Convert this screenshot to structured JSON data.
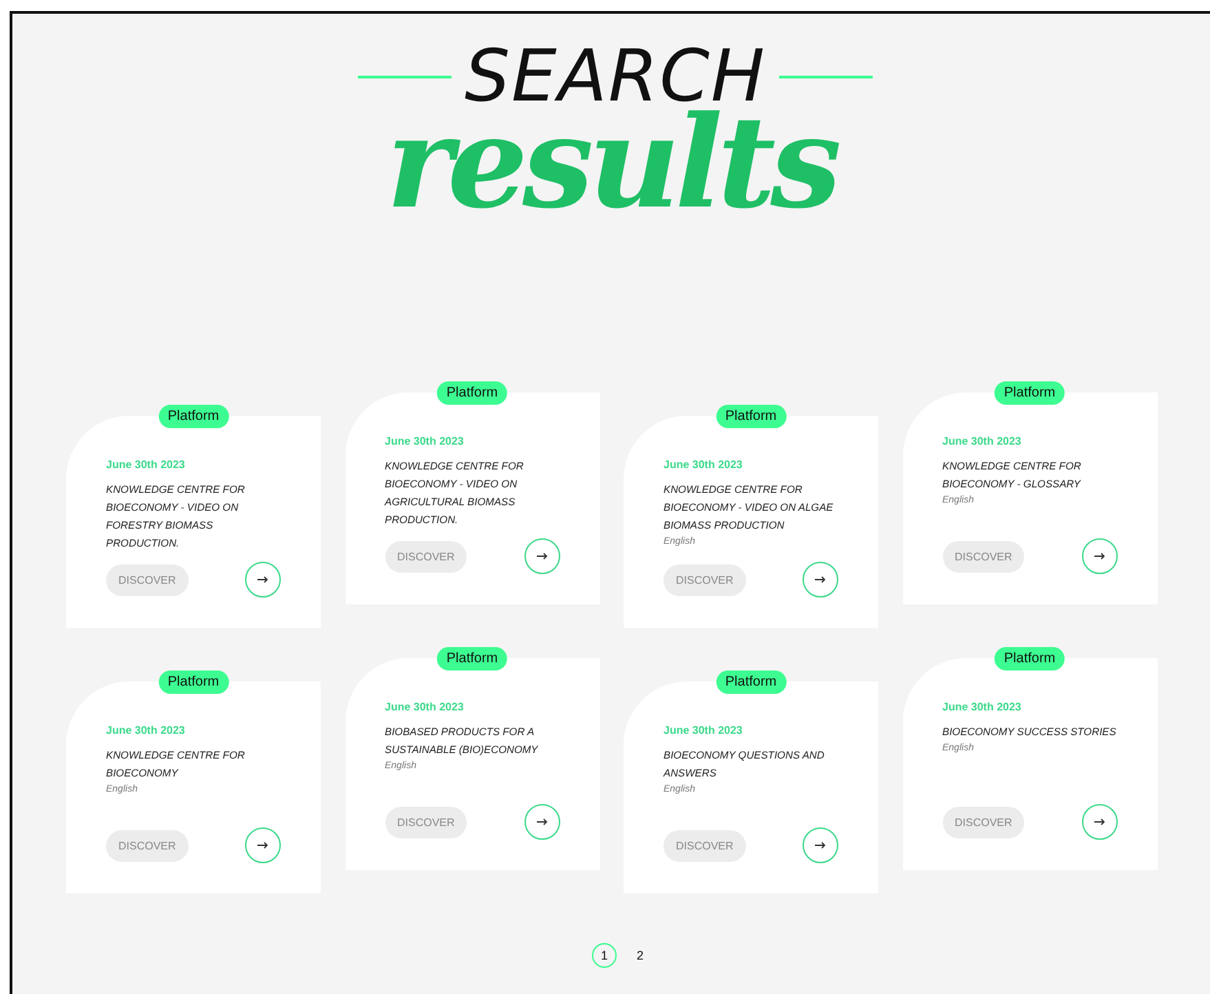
{
  "header": {
    "title_top": "SEARCH",
    "title_script": "results"
  },
  "results": [
    {
      "badge": "Platform",
      "date": "June 30th 2023",
      "title": "KNOWLEDGE CENTRE FOR BIOECONOMY - VIDEO ON FORESTRY BIOMASS PRODUCTION.",
      "button": "DISCOVER"
    },
    {
      "badge": "Platform",
      "date": "June 30th 2023",
      "title": "KNOWLEDGE CENTRE FOR BIOECONOMY - VIDEO ON AGRICULTURAL BIOMASS PRODUCTION.",
      "button": "DISCOVER"
    },
    {
      "badge": "Platform",
      "date": "June 30th 2023",
      "title": "KNOWLEDGE CENTRE FOR BIOECONOMY - VIDEO ON ALGAE BIOMASS PRODUCTION",
      "language": "English",
      "button": "DISCOVER"
    },
    {
      "badge": "Platform",
      "date": "June 30th 2023",
      "title": "KNOWLEDGE CENTRE FOR BIOECONOMY - GLOSSARY",
      "language": "English",
      "button": "DISCOVER"
    },
    {
      "badge": "Platform",
      "date": "June 30th 2023",
      "title": "KNOWLEDGE CENTRE FOR BIOECONOMY",
      "language": "English",
      "button": "DISCOVER"
    },
    {
      "badge": "Platform",
      "date": "June 30th 2023",
      "title": "BIOBASED PRODUCTS FOR A SUSTAINABLE (BIO)ECONOMY",
      "language": "English",
      "button": "DISCOVER"
    },
    {
      "badge": "Platform",
      "date": "June 30th 2023",
      "title": "BIOECONOMY QUESTIONS AND ANSWERS",
      "language": "English",
      "button": "DISCOVER"
    },
    {
      "badge": "Platform",
      "date": "June 30th 2023",
      "title": "BIOECONOMY SUCCESS STORIES",
      "language": "English",
      "button": "DISCOVER"
    }
  ],
  "pagination": [
    {
      "label": "1",
      "selected": true
    },
    {
      "label": "2",
      "selected": false
    }
  ]
}
